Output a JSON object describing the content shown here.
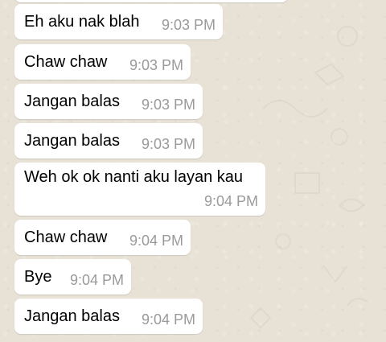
{
  "messages": [
    {
      "text": "Eh aku nak blah",
      "time": "9:03 PM"
    },
    {
      "text": "Chaw chaw",
      "time": "9:03 PM"
    },
    {
      "text": "Jangan balas",
      "time": "9:03 PM"
    },
    {
      "text": "Jangan balas",
      "time": "9:03 PM"
    },
    {
      "text": "Weh ok ok nanti aku layan kau",
      "time": "9:04 PM"
    },
    {
      "text": "Chaw chaw",
      "time": "9:04 PM"
    },
    {
      "text": "Bye",
      "time": "9:04 PM"
    },
    {
      "text": "Jangan balas",
      "time": "9:04 PM"
    }
  ]
}
